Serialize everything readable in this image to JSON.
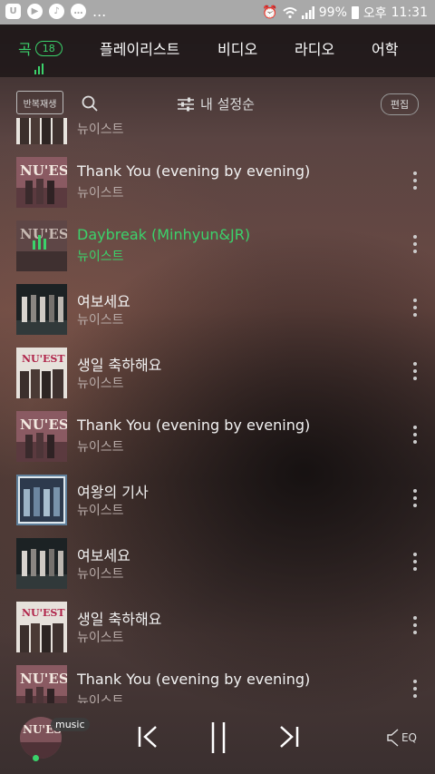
{
  "status_bar": {
    "battery": "99%",
    "ampm": "오후",
    "time": "11:31",
    "more": "..."
  },
  "tabs": [
    {
      "label": "곡",
      "count": "18",
      "active": true
    },
    {
      "label": "플레이리스트"
    },
    {
      "label": "비디오"
    },
    {
      "label": "라디오"
    },
    {
      "label": "어학"
    }
  ],
  "toolbar": {
    "repeat_label": "반복재생",
    "sort_label": "내 설정순",
    "edit_label": "편집"
  },
  "songs": [
    {
      "title": "",
      "artist": "뉴이스트",
      "cover": "white"
    },
    {
      "title": "Thank You (evening by evening)",
      "artist": "뉴이스트",
      "cover": "pink"
    },
    {
      "title": "Daybreak (Minhyun&JR)",
      "artist": "뉴이스트",
      "cover": "pink",
      "playing": true
    },
    {
      "title": "여보세요",
      "artist": "뉴이스트",
      "cover": "dark"
    },
    {
      "title": "생일 축하해요",
      "artist": "뉴이스트",
      "cover": "white"
    },
    {
      "title": "Thank You (evening by evening)",
      "artist": "뉴이스트",
      "cover": "pink"
    },
    {
      "title": "여왕의 기사",
      "artist": "뉴이스트",
      "cover": "blue"
    },
    {
      "title": "여보세요",
      "artist": "뉴이스트",
      "cover": "dark"
    },
    {
      "title": "생일 축하해요",
      "artist": "뉴이스트",
      "cover": "white"
    },
    {
      "title": "Thank You (evening by evening)",
      "artist": "뉴이스트",
      "cover": "pink"
    }
  ],
  "player": {
    "tag": "music",
    "eq_label": "EQ"
  },
  "colors": {
    "accent": "#3bd26b"
  }
}
